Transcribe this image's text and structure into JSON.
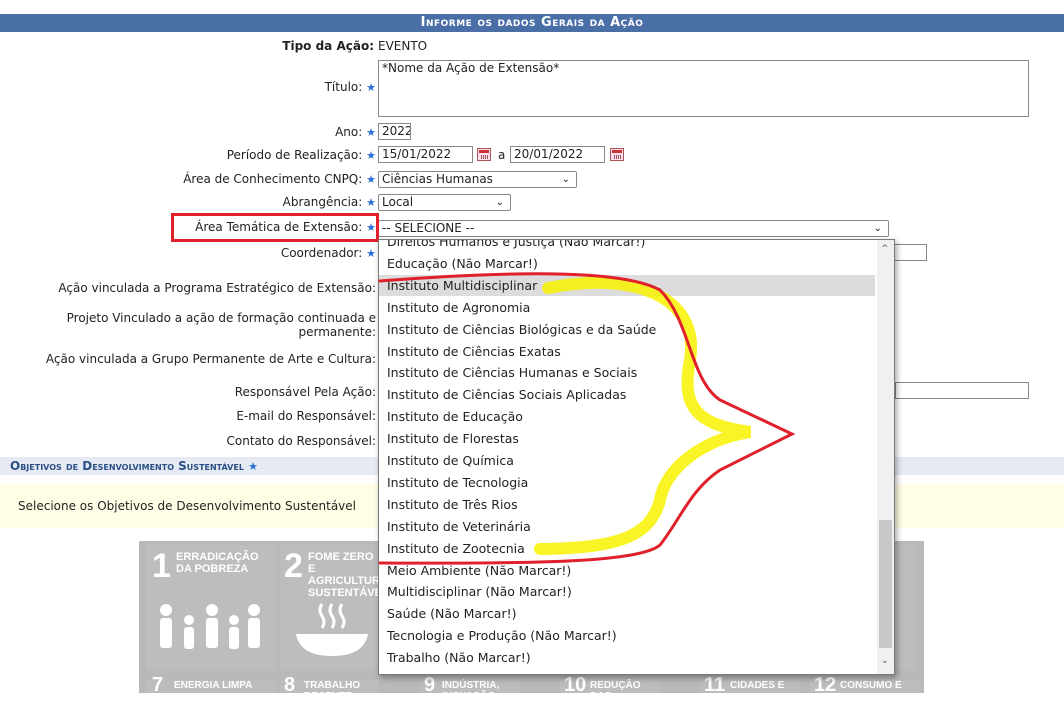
{
  "form": {
    "section_title": "Informe os dados Gerais da Ação",
    "tipo_label": "Tipo da Ação:",
    "tipo_value": "EVENTO",
    "titulo_label": "Título:",
    "titulo_value": "*Nome da Ação de Extensão*",
    "ano_label": "Ano:",
    "ano_value": "2022",
    "periodo_label": "Período de Realização:",
    "periodo_inicio": "15/01/2022",
    "periodo_sep": "a",
    "periodo_fim": "20/01/2022",
    "area_cnpq_label": "Área de Conhecimento CNPQ:",
    "area_cnpq_value": "Ciências Humanas",
    "abrangencia_label": "Abrangência:",
    "abrangencia_value": "Local",
    "area_tematica_label": "Área Temática de Extensão:",
    "area_tematica_value": "-- SELECIONE --",
    "coordenador_label": "Coordenador:",
    "programa_label": "Ação vinculada a Programa Estratégico de Extensão:",
    "projeto_label_1": "Projeto Vinculado a ação de formação continuada e",
    "projeto_label_2": "permanente:",
    "grupo_label": "Ação vinculada a Grupo Permanente de Arte e Cultura:",
    "responsavel_label": "Responsável Pela Ação:",
    "email_label": "E-mail do Responsável:",
    "contato_label": "Contato do Responsável:",
    "required_star": "★"
  },
  "ods": {
    "title": "Objetivos de Desenvolvimento Sustentável",
    "note": "Selecione os Objetivos de Desenvolvimento Sustentável",
    "cards": [
      {
        "num": "1",
        "text": "ERRADICAÇÃO DA POBREZA",
        "color": "#e5243b"
      },
      {
        "num": "2",
        "text": "FOME ZERO E AGRICULTURA SUSTENTÁVEL",
        "color": "#dda63a"
      },
      {
        "num": "7",
        "text": "ENERGIA LIMPA",
        "color": "#fcc30b"
      },
      {
        "num": "8",
        "text": "TRABALHO DECENTE",
        "color": "#a21942"
      },
      {
        "num": "9",
        "text": "INDÚSTRIA, INOVAÇÃO",
        "color": "#fd6925"
      },
      {
        "num": "10",
        "text": "REDUÇÃO DAS",
        "color": "#dd1367"
      },
      {
        "num": "11",
        "text": "CIDADES E",
        "color": "#fd9d24"
      },
      {
        "num": "12",
        "text": "CONSUMO E",
        "color": "#bf8b2e"
      }
    ]
  },
  "dropdown": {
    "options": [
      "Direitos Humanos e Justiça (Não Marcar!)",
      "Educação (Não Marcar!)",
      "Instituto Multidisciplinar",
      "Instituto de Agronomia",
      "Instituto de Ciências Biológicas e da Saúde",
      "Instituto de Ciências Exatas",
      "Instituto de Ciências Humanas e Sociais",
      "Instituto de Ciências Sociais Aplicadas",
      "Instituto de Educação",
      "Instituto de Florestas",
      "Instituto de Química",
      "Instituto de Tecnologia",
      "Instituto de Três Rios",
      "Instituto de Veterinária",
      "Instituto de Zootecnia",
      "Meio Ambiente (Não Marcar!)",
      "Multidisciplinar (Não Marcar!)",
      "Saúde (Não Marcar!)",
      "Tecnologia e Produção (Não Marcar!)",
      "Trabalho (Não Marcar!)"
    ],
    "highlighted": "Instituto Multidisciplinar"
  },
  "colors": {
    "header": "#4a6ea6",
    "annotation_red": "#e0202a",
    "annotation_yellow": "#f7f200"
  }
}
